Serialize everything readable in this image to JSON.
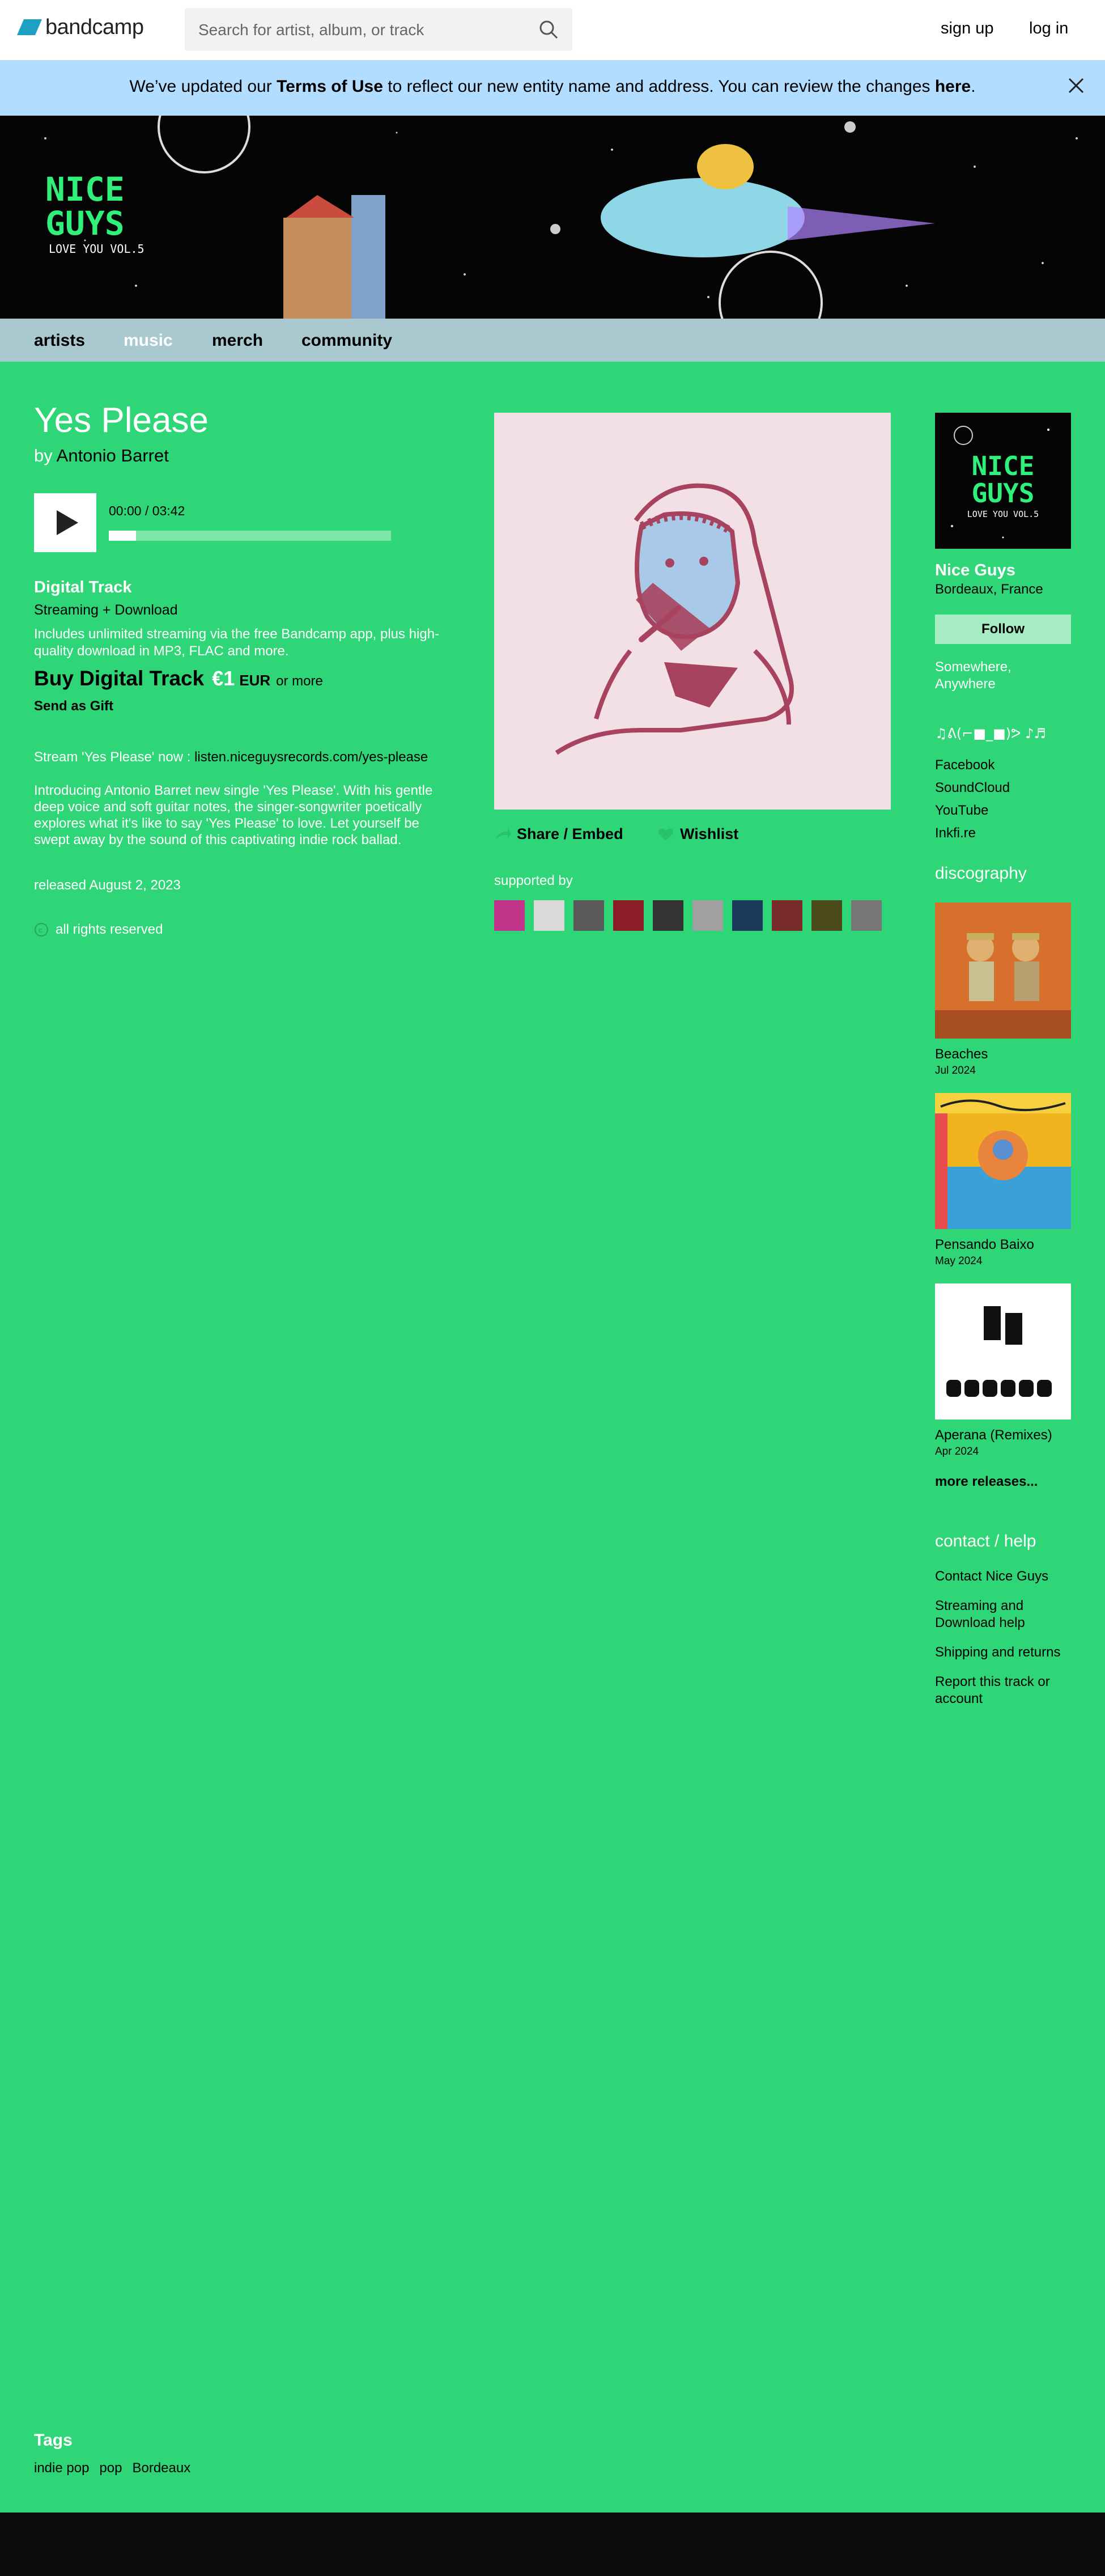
{
  "header": {
    "logo_text": "bandcamp",
    "search_placeholder": "Search for artist, album, or track",
    "signup_label": "sign up",
    "login_label": "log in"
  },
  "notice": {
    "pre": "We’ve updated our ",
    "terms": "Terms of Use",
    "mid": " to reflect our new entity name and address. You can review the changes ",
    "here": "here",
    "end": "."
  },
  "banner": {
    "logo_line1": "NICE",
    "logo_line2": "GUYS",
    "logo_line3": "LOVE YOU VOL.5"
  },
  "nav": {
    "items": [
      "artists",
      "music",
      "merch",
      "community"
    ],
    "active": "music"
  },
  "track": {
    "title": "Yes Please",
    "by_prefix": "by ",
    "artist": "Antonio Barret",
    "time": "00:00 / 03:42",
    "progress": 0.0
  },
  "purchase": {
    "format_title": "Digital Track",
    "format_sub": "Streaming + Download",
    "description": "Includes unlimited streaming via the free Bandcamp app, plus high-quality download in MP3, FLAC and more.",
    "buy_label": "Buy Digital Track",
    "price": "€1",
    "currency": "EUR",
    "or_more": "or more",
    "gift_label": "Send as Gift"
  },
  "about": {
    "stream_prefix": "Stream 'Yes Please' now : ",
    "stream_url": "listen.niceguysrecords.com/yes-please",
    "intro": "Introducing Antonio Barret new single 'Yes Please'. With his gentle deep voice and soft guitar notes, the singer-songwriter poetically explores what it's like to say 'Yes Please' to love. Let yourself be swept away by the sound of this captivating indie rock ballad.",
    "released": "released August 2, 2023",
    "rights": "all rights reserved"
  },
  "actions": {
    "share_label": "Share / Embed",
    "wishlist_label": "Wishlist",
    "supported_label": "supported by"
  },
  "supporters": [
    "#c2358a",
    "#d9d9d9",
    "#5a5a5a",
    "#8c1e2a",
    "#333333",
    "#a0a0a0",
    "#1a3b5a",
    "#7a2b2b",
    "#4a4a1a",
    "#777777"
  ],
  "label": {
    "art_line1": "NICE",
    "art_line2": "GUYS",
    "art_line3": "LOVE YOU VOL.5",
    "name": "Nice Guys",
    "location": "Bordeaux, France",
    "follow_label": "Follow",
    "tagline": "Somewhere, Anywhere",
    "kaomoji": "♫ᕕ(⌐■_■)ᕗ ♪♬",
    "links": [
      "Facebook",
      "SoundCloud",
      "YouTube",
      "Inkfi.re"
    ]
  },
  "discography": {
    "heading": "discography",
    "releases": [
      {
        "title": "Beaches",
        "date": "Jul 2024"
      },
      {
        "title": "Pensando Baixo",
        "date": "May 2024"
      },
      {
        "title": "Aperana (Remixes)",
        "date": "Apr 2024"
      }
    ],
    "more_label": "more releases..."
  },
  "contact": {
    "heading": "contact / help",
    "links": [
      "Contact Nice Guys",
      "Streaming and Download help",
      "Shipping and returns",
      "Report this track or account"
    ]
  },
  "tags": {
    "heading": "Tags",
    "items": [
      "indie pop",
      "pop",
      "Bordeaux"
    ]
  },
  "colors": {
    "page_bg": "#2ed677",
    "nav_bg": "#a9c8d0",
    "notice_bg": "#b3ddff"
  }
}
